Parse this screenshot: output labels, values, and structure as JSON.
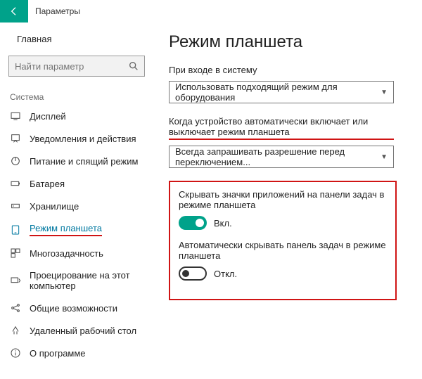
{
  "titlebar": {
    "app": "Параметры"
  },
  "sidebar": {
    "home": "Главная",
    "search_placeholder": "Найти параметр",
    "section": "Система",
    "items": [
      {
        "label": "Дисплей"
      },
      {
        "label": "Уведомления и действия"
      },
      {
        "label": "Питание и спящий режим"
      },
      {
        "label": "Батарея"
      },
      {
        "label": "Хранилище"
      },
      {
        "label": "Режим планшета"
      },
      {
        "label": "Многозадачность"
      },
      {
        "label": "Проецирование на этот компьютер"
      },
      {
        "label": "Общие возможности"
      },
      {
        "label": "Удаленный рабочий стол"
      },
      {
        "label": "О программе"
      }
    ]
  },
  "main": {
    "title": "Режим планшета",
    "signin_label": "При входе в систему",
    "signin_value": "Использовать подходящий режим для оборудования",
    "auto_label": "Когда устройство автоматически включает или выключает режим планшета",
    "auto_value": "Всегда запрашивать разрешение перед переключением...",
    "hide_icons_label": "Скрывать значки приложений на панели задач в режиме планшета",
    "hide_icons_state": "Вкл.",
    "autohide_label": "Автоматически скрывать панель задач в режиме планшета",
    "autohide_state": "Откл."
  }
}
